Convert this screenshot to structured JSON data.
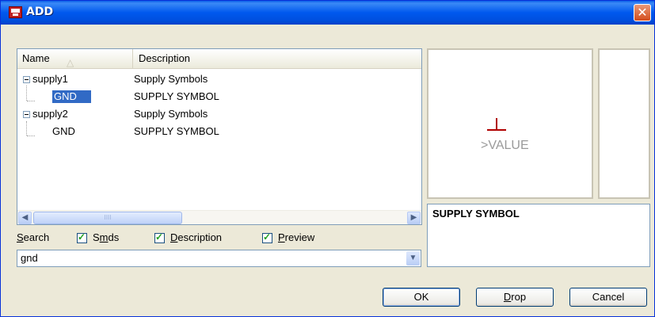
{
  "window": {
    "title": "ADD",
    "close_glyph": "✕"
  },
  "list": {
    "columns": {
      "name": "Name",
      "description": "Description"
    },
    "rows": [
      {
        "name": "supply1",
        "description": "Supply Symbols",
        "level": 0
      },
      {
        "name": "GND",
        "description": "SUPPLY SYMBOL",
        "level": 1,
        "selected": true
      },
      {
        "name": "supply2",
        "description": "Supply Symbols",
        "level": 0
      },
      {
        "name": "GND",
        "description": "SUPPLY SYMBOL",
        "level": 1
      }
    ],
    "scroll_thumb_grip": "IIII"
  },
  "search": {
    "label": "Search",
    "label_hotkey": "S",
    "label_rest": "earch",
    "options": [
      {
        "pre": "S",
        "hot": "m",
        "post": "ds",
        "checked": true
      },
      {
        "pre": "",
        "hot": "D",
        "post": "escription",
        "checked": true
      },
      {
        "pre": "",
        "hot": "P",
        "post": "review",
        "checked": true
      }
    ],
    "value": "gnd"
  },
  "preview": {
    "symbol_text": ">VALUE",
    "description": "SUPPLY SYMBOL"
  },
  "buttons": {
    "ok": "OK",
    "drop_hot": "D",
    "drop_rest": "rop",
    "cancel": "Cancel"
  }
}
